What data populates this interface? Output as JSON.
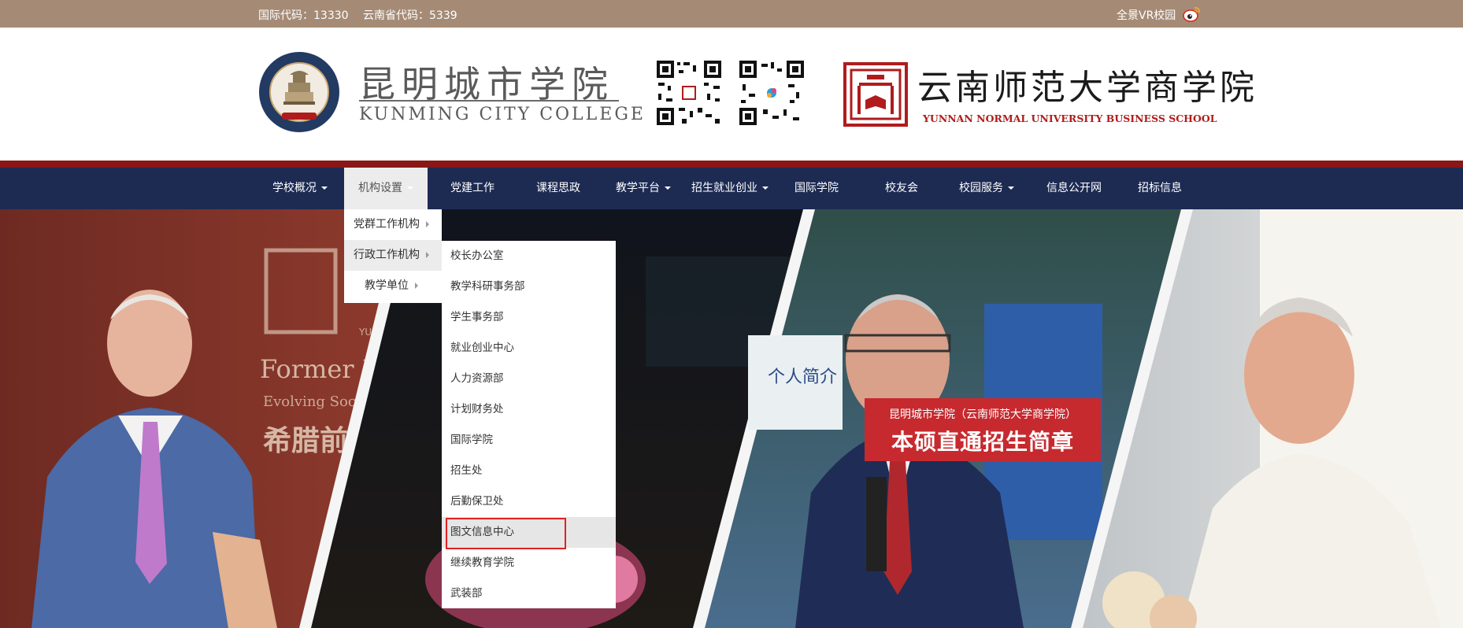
{
  "topbar": {
    "national_code": "国际代码：13330",
    "province_code": "云南省代码：5339",
    "vr_link": "全景VR校园",
    "weibo_icon": "weibo-icon"
  },
  "header": {
    "college_cn": "昆明城市学院",
    "college_en": "KUNMING CITY COLLEGE",
    "business_school_cn": "云南师范大学商学院",
    "business_school_en": "YUNNAN NORMAL UNIVERSITY BUSINESS SCHOOL",
    "colors": {
      "brand_red": "#b01c1c",
      "nav_blue": "#1d2b53",
      "topbar_brown": "#a58b76"
    }
  },
  "nav": {
    "items": [
      {
        "label": "学校概况",
        "has_dropdown": true
      },
      {
        "label": "机构设置",
        "has_dropdown": true,
        "active": true
      },
      {
        "label": "党建工作",
        "has_dropdown": false
      },
      {
        "label": "课程思政",
        "has_dropdown": false
      },
      {
        "label": "教学平台",
        "has_dropdown": true
      },
      {
        "label": "招生就业创业",
        "has_dropdown": true
      },
      {
        "label": "国际学院",
        "has_dropdown": false
      },
      {
        "label": "校友会",
        "has_dropdown": false
      },
      {
        "label": "校园服务",
        "has_dropdown": true
      },
      {
        "label": "信息公开网",
        "has_dropdown": false
      },
      {
        "label": "招标信息",
        "has_dropdown": false
      }
    ]
  },
  "dropdown": {
    "level1": [
      {
        "label": "党群工作机构"
      },
      {
        "label": "行政工作机构",
        "highlighted": true
      },
      {
        "label": "教学单位"
      }
    ],
    "level2": [
      {
        "label": "校长办公室"
      },
      {
        "label": "教学科研事务部"
      },
      {
        "label": "学生事务部"
      },
      {
        "label": "就业创业中心"
      },
      {
        "label": "人力资源部"
      },
      {
        "label": "计划财务处"
      },
      {
        "label": "国际学院"
      },
      {
        "label": "招生处"
      },
      {
        "label": "后勤保卫处"
      },
      {
        "label": "图文信息中心",
        "highlighted": true
      },
      {
        "label": "继续教育学院"
      },
      {
        "label": "武装部"
      }
    ]
  },
  "banner": {
    "promo_subtitle": "昆明城市学院（云南师范大学商学院）",
    "promo_title": "本硕直通招生简章",
    "bg_text_former": "Former P",
    "bg_text_evolving": "Evolving Soci",
    "bg_text_greek": "希腊前",
    "bg_text_yun": "YUN",
    "bg_text_board": "个人简介"
  }
}
